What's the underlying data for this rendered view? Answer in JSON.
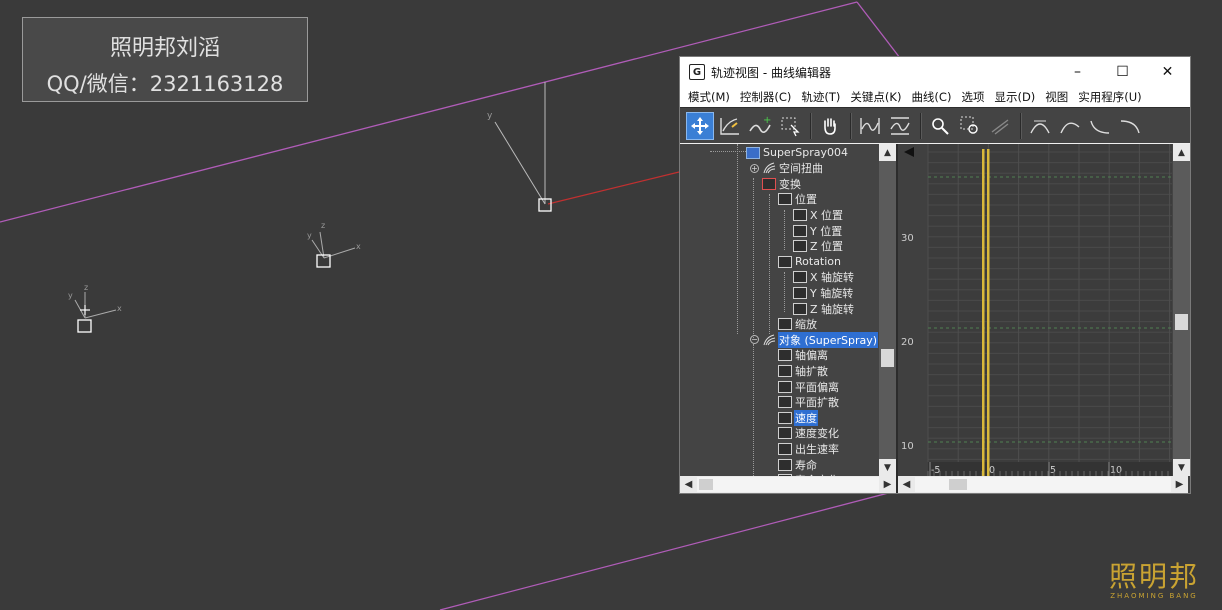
{
  "watermark": {
    "line1": "照明邦刘滔",
    "line2": "QQ/微信：2321163128"
  },
  "logo": {
    "cn": "照明邦",
    "en": "ZHAOMING BANG"
  },
  "viewport": {
    "axis_labels": [
      "x",
      "y",
      "z"
    ]
  },
  "window": {
    "title": "轨迹视图 - 曲线编辑器",
    "minimize": "–",
    "maximize": "☐",
    "close": "✕",
    "menu": [
      "模式(M)",
      "控制器(C)",
      "轨迹(T)",
      "关键点(K)",
      "曲线(C)",
      "选项",
      "显示(D)",
      "视图",
      "实用程序(U)"
    ]
  },
  "tree": {
    "items": [
      {
        "label": "SuperSpray004",
        "icon": "object-box-icon"
      },
      {
        "label": "空间扭曲",
        "icon": "spacewarp-icon"
      },
      {
        "label": "变换",
        "icon": "transform-icon"
      },
      {
        "label": "位置",
        "icon": "position-icon"
      },
      {
        "label": "X 位置",
        "icon": "track-icon"
      },
      {
        "label": "Y 位置",
        "icon": "track-icon"
      },
      {
        "label": "Z 位置",
        "icon": "track-icon"
      },
      {
        "label": "Rotation",
        "icon": "rotation-icon"
      },
      {
        "label": "X 轴旋转",
        "icon": "track-icon"
      },
      {
        "label": "Y 轴旋转",
        "icon": "track-icon"
      },
      {
        "label": "Z 轴旋转",
        "icon": "track-icon"
      },
      {
        "label": "缩放",
        "icon": "scale-icon"
      },
      {
        "label": "对象 (SuperSpray)",
        "icon": "spacewarp-icon"
      },
      {
        "label": "轴偏离",
        "icon": "track-icon"
      },
      {
        "label": "轴扩散",
        "icon": "track-icon"
      },
      {
        "label": "平面偏离",
        "icon": "track-icon"
      },
      {
        "label": "平面扩散",
        "icon": "track-icon"
      },
      {
        "label": "速度",
        "icon": "track-icon"
      },
      {
        "label": "速度变化",
        "icon": "track-icon"
      },
      {
        "label": "出生速率",
        "icon": "track-icon"
      },
      {
        "label": "寿命",
        "icon": "track-icon"
      },
      {
        "label": "寿命变化",
        "icon": "track-icon"
      }
    ],
    "selected": [
      12,
      17
    ]
  },
  "curve": {
    "y_ticks": [
      "30",
      "20",
      "10"
    ],
    "x_ticks": [
      "-5",
      "0",
      "5",
      "10"
    ],
    "accent": "#d9b93b"
  }
}
